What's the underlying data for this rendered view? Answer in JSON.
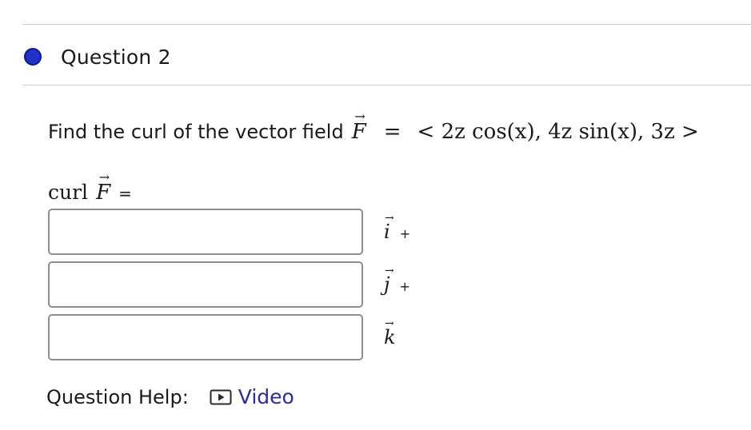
{
  "question": {
    "title": "Question 2",
    "prompt_text": "Find the curl of the vector field",
    "field_symbol": "F",
    "arrow": "→",
    "equals": "=",
    "field_expression": "< 2z cos(x), 4z sin(x), 3z >"
  },
  "answer": {
    "curl_word": "curl",
    "field_symbol": "F",
    "equals": "=",
    "inputs": [
      {
        "value": "",
        "unit": "i",
        "suffix": "+"
      },
      {
        "value": "",
        "unit": "j",
        "suffix": "+"
      },
      {
        "value": "",
        "unit": "k",
        "suffix": ""
      }
    ]
  },
  "help": {
    "label": "Question Help:",
    "video_label": "Video",
    "video_icon": "play-icon"
  },
  "colors": {
    "dot": "#1f31c6",
    "link": "#2a2aa8",
    "rule": "#cfcfcf",
    "input_border": "#8e8e8e"
  }
}
